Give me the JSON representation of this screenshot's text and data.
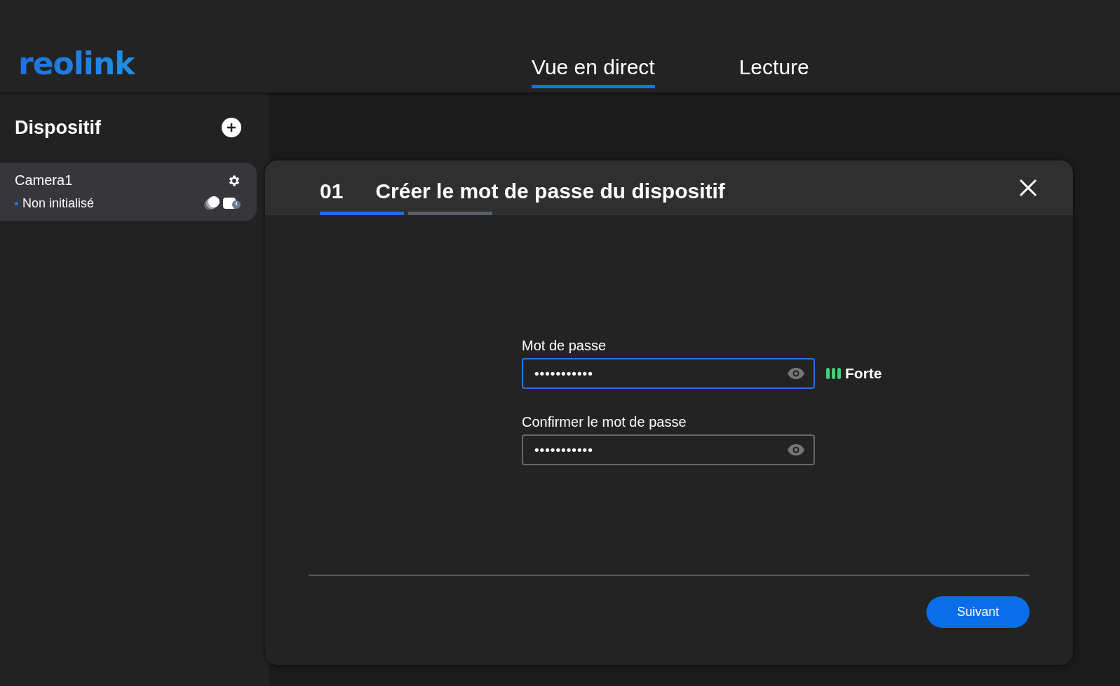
{
  "logo": {
    "text": "reolink"
  },
  "nav": {
    "tabs": [
      {
        "label": "Vue en direct",
        "selected": true
      },
      {
        "label": "Lecture",
        "selected": false
      }
    ]
  },
  "sidebar": {
    "title": "Dispositif",
    "devices": [
      {
        "name": "Camera1",
        "status": "Non initialisé",
        "color": "#1a7cf0",
        "selected": true
      }
    ]
  },
  "dialog": {
    "step_number": "01",
    "title": "Créer le mot de passe du dispositif",
    "steps": [
      {
        "selected": true
      },
      {
        "selected": false
      }
    ],
    "fields": [
      {
        "label": "Mot de passe",
        "value": "•••••••••••",
        "focused": true,
        "strength": {
          "bars": [
            {
              "on": true
            },
            {
              "on": true
            },
            {
              "on": true
            }
          ],
          "label": "Forte"
        }
      },
      {
        "label": "Confirmer le mot de passe",
        "value": "•••••••••••",
        "focused": false
      }
    ],
    "button": "Suivant"
  }
}
